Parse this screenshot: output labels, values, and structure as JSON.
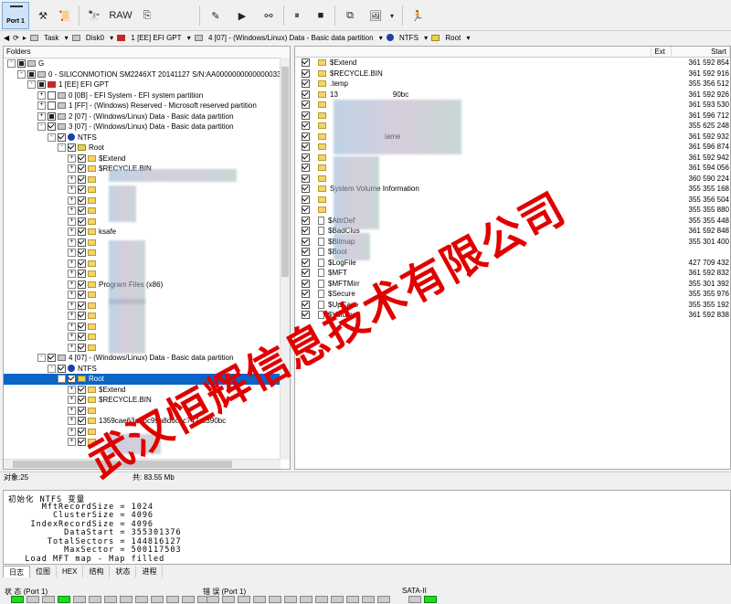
{
  "toolbar": {
    "port_label": "Port 1",
    "raw_label": "RAW"
  },
  "path": {
    "task": "Task",
    "disk": "Disk0",
    "part1": "1 [EE] EFI GPT",
    "part4": "4 [07] - (Windows/Linux) Data - Basic data partition",
    "fs": "NTFS",
    "root": "Root"
  },
  "left_panel": {
    "header": "Folders",
    "rows": [
      {
        "text": "G",
        "indent": 0,
        "exp": "-",
        "cb": "part",
        "icon": "drive"
      },
      {
        "text": "0 - SILICONMOTION SM2246XT 20141127 S/N:AA00000000000000339",
        "indent": 1,
        "exp": "-",
        "cb": "part",
        "icon": "drive"
      },
      {
        "text": "1 [EE] EFI GPT",
        "indent": 2,
        "exp": "-",
        "cb": "part",
        "icon": "red"
      },
      {
        "text": "0 [0B] - EFI System - EFI system partition",
        "indent": 3,
        "exp": "+",
        "cb": "",
        "icon": "drive"
      },
      {
        "text": "1 [FF] - (Windows) Reserved - Microsoft reserved partition",
        "indent": 3,
        "exp": "+",
        "cb": "",
        "icon": "drive"
      },
      {
        "text": "2 [07] - (Windows/Linux) Data - Basic data partition",
        "indent": 3,
        "exp": "+",
        "cb": "part",
        "icon": "drive"
      },
      {
        "text": "3 [07] - (Windows/Linux) Data - Basic data partition",
        "indent": 3,
        "exp": "-",
        "cb": "on",
        "icon": "drive"
      },
      {
        "text": "NTFS",
        "indent": 4,
        "exp": "-",
        "cb": "on",
        "icon": "ntfs"
      },
      {
        "text": "Root",
        "indent": 5,
        "exp": "-",
        "cb": "on",
        "icon": "root"
      },
      {
        "text": "$Extend",
        "indent": 6,
        "exp": "+",
        "cb": "on",
        "icon": "folder"
      },
      {
        "text": "$RECYCLE.BIN",
        "indent": 6,
        "exp": "+",
        "cb": "on",
        "icon": "folder"
      },
      {
        "text": "",
        "indent": 6,
        "exp": "+",
        "cb": "on",
        "icon": "folder"
      },
      {
        "text": "",
        "indent": 6,
        "exp": "+",
        "cb": "on",
        "icon": "folder"
      },
      {
        "text": "",
        "indent": 6,
        "exp": "+",
        "cb": "on",
        "icon": "folder"
      },
      {
        "text": "",
        "indent": 6,
        "exp": "+",
        "cb": "on",
        "icon": "folder"
      },
      {
        "text": "",
        "indent": 6,
        "exp": "+",
        "cb": "on",
        "icon": "folder"
      },
      {
        "text": "ksafe",
        "indent": 6,
        "exp": "+",
        "cb": "on",
        "icon": "folder"
      },
      {
        "text": "",
        "indent": 6,
        "exp": "+",
        "cb": "on",
        "icon": "folder"
      },
      {
        "text": "",
        "indent": 6,
        "exp": "+",
        "cb": "on",
        "icon": "folder"
      },
      {
        "text": "",
        "indent": 6,
        "exp": "+",
        "cb": "on",
        "icon": "folder"
      },
      {
        "text": "",
        "indent": 6,
        "exp": "+",
        "cb": "on",
        "icon": "folder"
      },
      {
        "text": "Program Files (x86)",
        "indent": 6,
        "exp": "+",
        "cb": "on",
        "icon": "folder"
      },
      {
        "text": "",
        "indent": 6,
        "exp": "+",
        "cb": "on",
        "icon": "folder"
      },
      {
        "text": "",
        "indent": 6,
        "exp": "+",
        "cb": "on",
        "icon": "folder"
      },
      {
        "text": "",
        "indent": 6,
        "exp": "+",
        "cb": "on",
        "icon": "folder"
      },
      {
        "text": "",
        "indent": 6,
        "exp": "+",
        "cb": "on",
        "icon": "folder"
      },
      {
        "text": "",
        "indent": 6,
        "exp": "+",
        "cb": "on",
        "icon": "folder"
      },
      {
        "text": "",
        "indent": 6,
        "exp": "+",
        "cb": "on",
        "icon": "folder"
      },
      {
        "text": "4 [07] - (Windows/Linux) Data - Basic data partition",
        "indent": 3,
        "exp": "-",
        "cb": "on",
        "icon": "drive"
      },
      {
        "text": "NTFS",
        "indent": 4,
        "exp": "-",
        "cb": "on",
        "icon": "ntfs"
      },
      {
        "text": "Root",
        "indent": 5,
        "exp": "-",
        "cb": "on",
        "icon": "root",
        "selected": true
      },
      {
        "text": "$Extend",
        "indent": 6,
        "exp": "+",
        "cb": "on",
        "icon": "folder"
      },
      {
        "text": "$RECYCLE.BIN",
        "indent": 6,
        "exp": "+",
        "cb": "on",
        "icon": "folder"
      },
      {
        "text": "",
        "indent": 6,
        "exp": "+",
        "cb": "on",
        "icon": "folder"
      },
      {
        "text": "1359cae63a9bc99a8d6c1c747cc390bc",
        "indent": 6,
        "exp": "+",
        "cb": "on",
        "icon": "folder"
      },
      {
        "text": "",
        "indent": 6,
        "exp": "+",
        "cb": "on",
        "icon": "folder"
      },
      {
        "text": "",
        "indent": 6,
        "exp": "+",
        "cb": "on",
        "icon": "folder"
      }
    ]
  },
  "right_panel": {
    "col_ext": "Ext",
    "col_start": "Start",
    "rows": [
      {
        "name": "$Extend",
        "icon": "folder",
        "start": "361 592 854"
      },
      {
        "name": "$RECYCLE.BIN",
        "icon": "folder",
        "start": "361 592 916"
      },
      {
        "name": ".temp",
        "icon": "folder",
        "start": "355 356 512"
      },
      {
        "name": "13",
        "icon": "folder",
        "start": "361 592 926",
        "extra": "90bc"
      },
      {
        "name": "",
        "icon": "folder",
        "start": "361 593 530"
      },
      {
        "name": "",
        "icon": "folder",
        "start": "361 596 712"
      },
      {
        "name": "",
        "icon": "folder",
        "start": "355 625 248"
      },
      {
        "name": "",
        "icon": "folder",
        "start": "361 592 932",
        "extra": "iame"
      },
      {
        "name": "",
        "icon": "folder",
        "start": "361 596 874"
      },
      {
        "name": "",
        "icon": "folder",
        "start": "361 592 942"
      },
      {
        "name": "",
        "icon": "folder",
        "start": "361 594 056"
      },
      {
        "name": "",
        "icon": "folder",
        "start": "360 590 224"
      },
      {
        "name": "System Volume Information",
        "icon": "folder",
        "start": "355 355 168"
      },
      {
        "name": "",
        "icon": "folder",
        "start": "355 356 504"
      },
      {
        "name": "",
        "icon": "folder",
        "start": "355 355 880"
      },
      {
        "name": "$AttrDef",
        "icon": "file",
        "start": "355 355 448"
      },
      {
        "name": "$BadClus",
        "icon": "file",
        "start": "361 592 848"
      },
      {
        "name": "$Bitmap",
        "icon": "file",
        "start": "355 301 400"
      },
      {
        "name": "$Boot",
        "icon": "file",
        "start": ""
      },
      {
        "name": "$LogFile",
        "icon": "file",
        "start": "427 709 432"
      },
      {
        "name": "$MFT",
        "icon": "file",
        "start": "361 592 832"
      },
      {
        "name": "$MFTMirr",
        "icon": "file",
        "start": "355 301 392"
      },
      {
        "name": "$Secure",
        "icon": "file",
        "start": "355 355 976"
      },
      {
        "name": "$UpCase",
        "icon": "file",
        "start": "355 355 192"
      },
      {
        "name": "$Volume",
        "icon": "file",
        "start": "361 592 838"
      }
    ]
  },
  "status": {
    "objects": "对象:25",
    "total": "共: 83.55 Mb"
  },
  "log": {
    "lines": [
      "初始化 NTFS 变量",
      "      MftRecordSize = 1024",
      "        ClusterSize = 4096",
      "    IndexRecordSize = 4096",
      "          DataStart = 355301376",
      "       TotalSectors = 144816127",
      "          MaxSector = 500117503",
      "   Load MFT map - Map filled"
    ]
  },
  "tabs": [
    "日志",
    "位图",
    "HEX",
    "结构",
    "状态",
    "进程"
  ],
  "bottom": {
    "state_label": "状 态 (Port 1)",
    "error_label": "错 误 (Port 1)",
    "sata_label": "SATA-II",
    "state_leds": [
      "green",
      "off",
      "off",
      "green",
      "off",
      "off",
      "off",
      "off",
      "off",
      "off",
      "off",
      "off",
      "off"
    ],
    "error_leds": [
      "off",
      "off",
      "off",
      "off",
      "off",
      "off",
      "off",
      "off",
      "off",
      "off",
      "off",
      "off"
    ],
    "sata_leds": [
      "off",
      "green"
    ]
  },
  "watermark": "武汉恒辉信息技术有限公司"
}
